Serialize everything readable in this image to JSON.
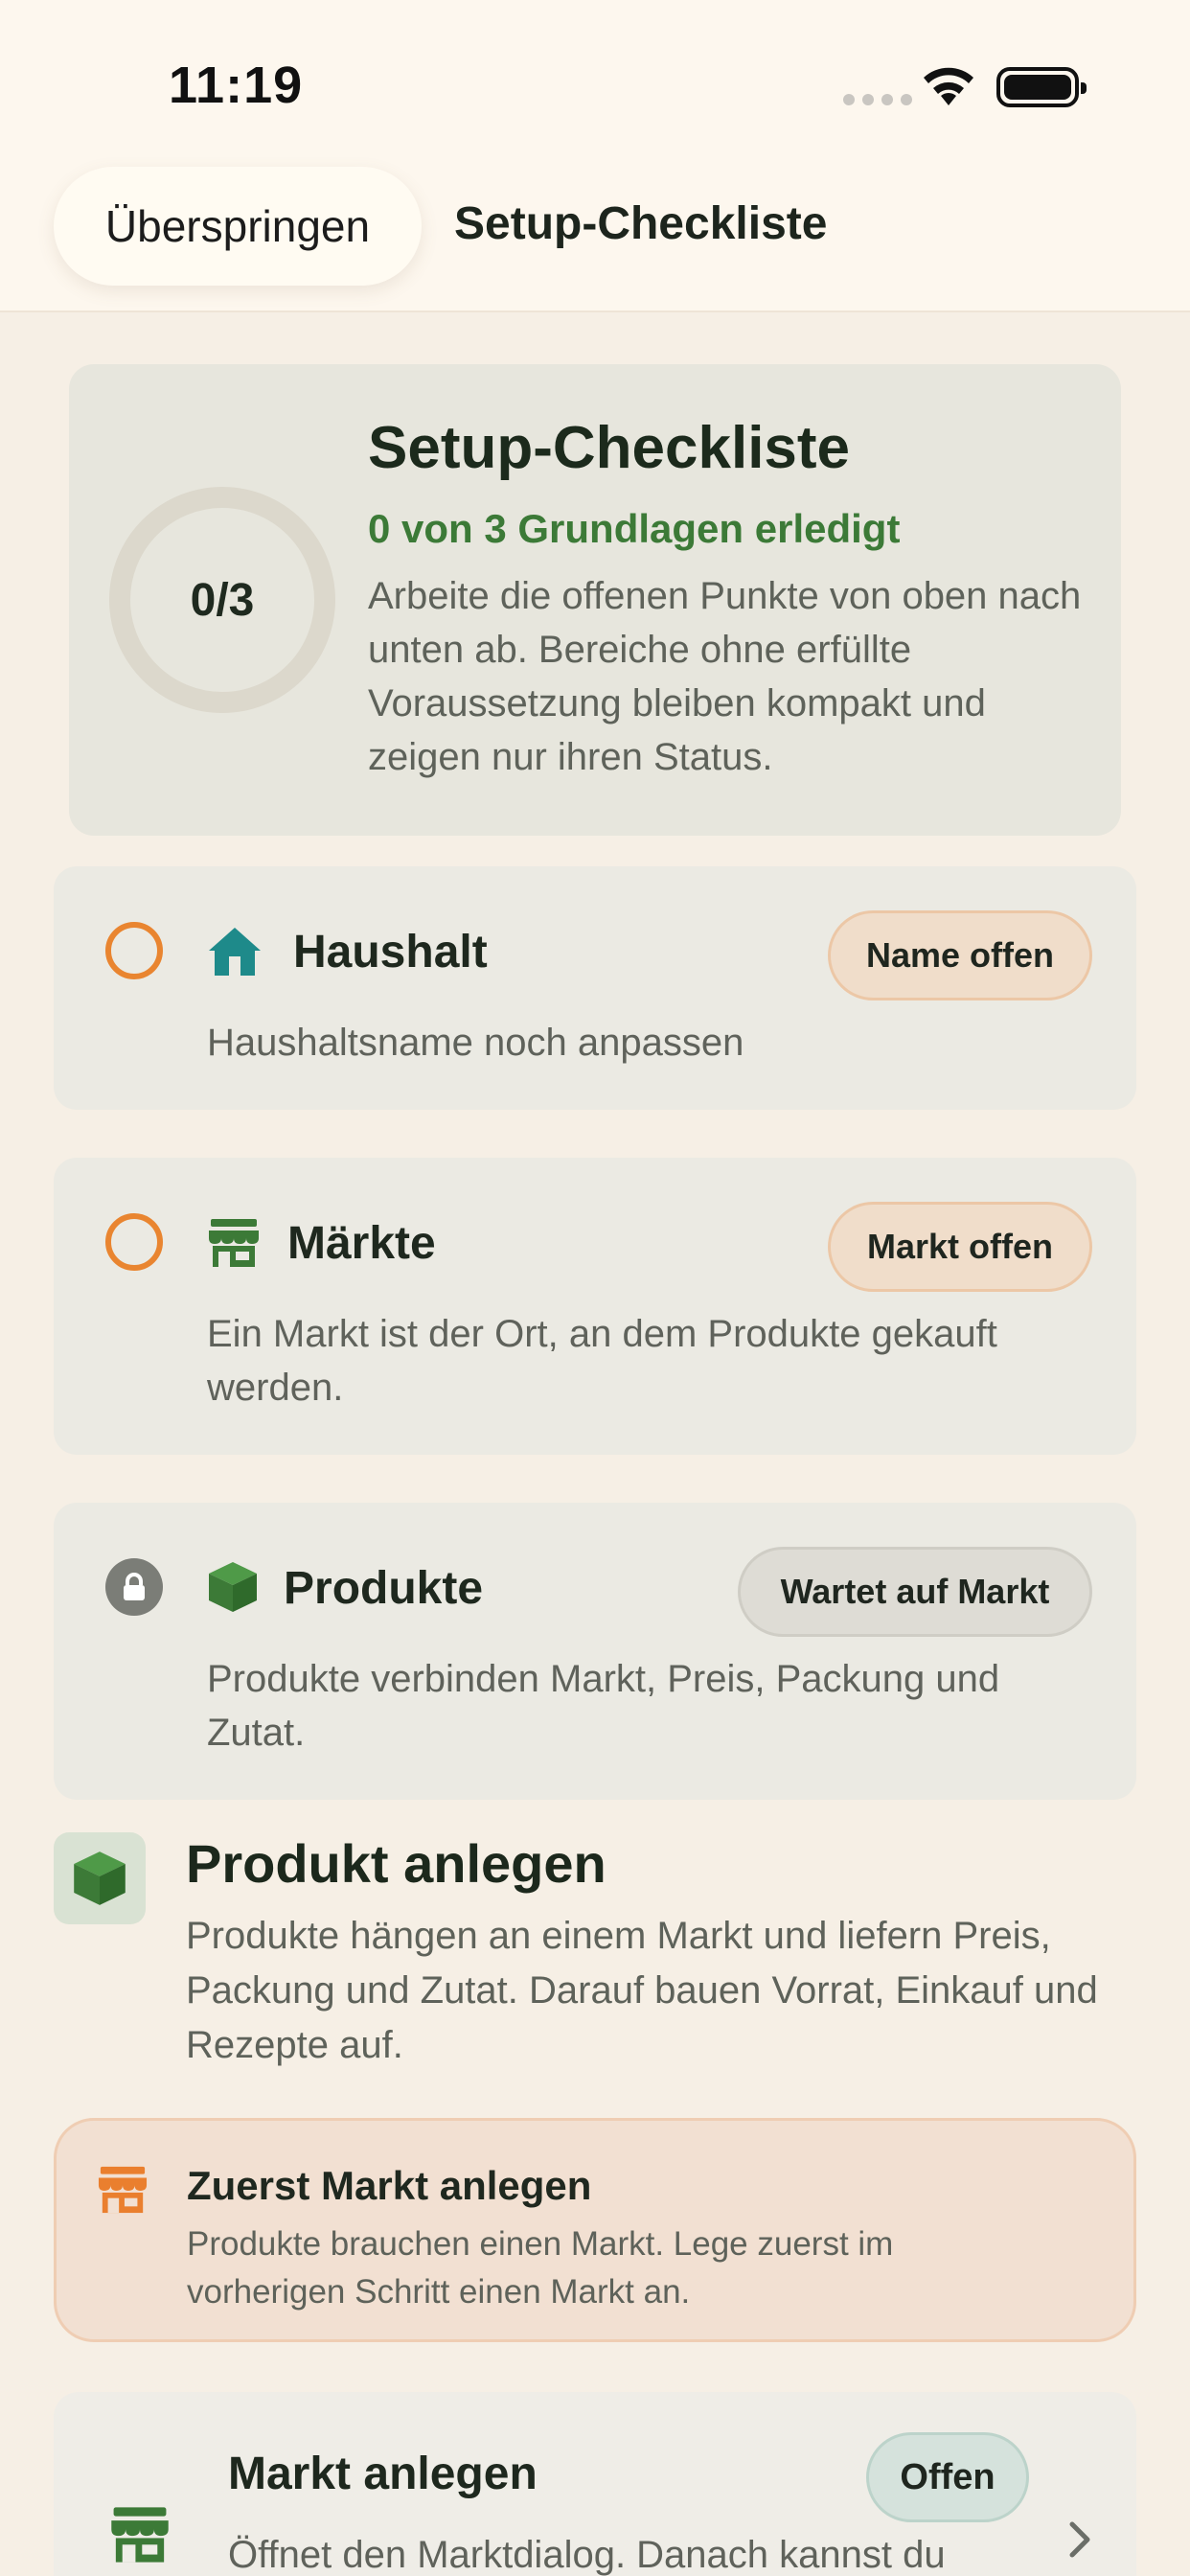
{
  "status_bar": {
    "time": "11:19"
  },
  "nav": {
    "skip_label": "Überspringen",
    "title": "Setup-Checkliste"
  },
  "summary": {
    "progress_ring": "0/3",
    "progress_fraction": 0,
    "title": "Setup-Checkliste",
    "progress_text": "0 von 3 Grundlagen erledigt",
    "description": "Arbeite die offenen Punkte von oben nach unten ab. Bereiche ohne erfüllte Voraussetzung bleiben kompakt und zeigen nur ihren Status."
  },
  "checklist": [
    {
      "title": "Haushalt",
      "status": "Name offen",
      "description": "Haushaltsname noch anpassen",
      "icon": "house-icon",
      "state": "open"
    },
    {
      "title": "Märkte",
      "status": "Markt offen",
      "description": "Ein Markt ist der Ort, an dem Produkte gekauft werden.",
      "icon": "store-icon",
      "state": "open"
    },
    {
      "title": "Produkte",
      "status": "Wartet auf Markt",
      "description": "Produkte verbinden Markt, Preis, Packung und Zutat.",
      "icon": "box-icon",
      "state": "locked"
    }
  ],
  "produkt_section": {
    "title": "Produkt anlegen",
    "description": "Produkte hängen an einem Markt und liefern Preis, Packung und Zutat. Darauf bauen Vorrat, Einkauf und Rezepte auf."
  },
  "warning": {
    "title": "Zuerst Markt anlegen",
    "description": "Produkte brauchen einen Markt. Lege zuerst im vorherigen Schritt einen Markt an."
  },
  "action": {
    "title": "Markt anlegen",
    "badge": "Offen",
    "description": "Öffnet den Marktdialog. Danach kannst du"
  },
  "colors": {
    "accent_green": "#3c7a37",
    "accent_orange": "#e98530",
    "teal_icon": "#1e8a8a",
    "background": "#f6efe5"
  }
}
